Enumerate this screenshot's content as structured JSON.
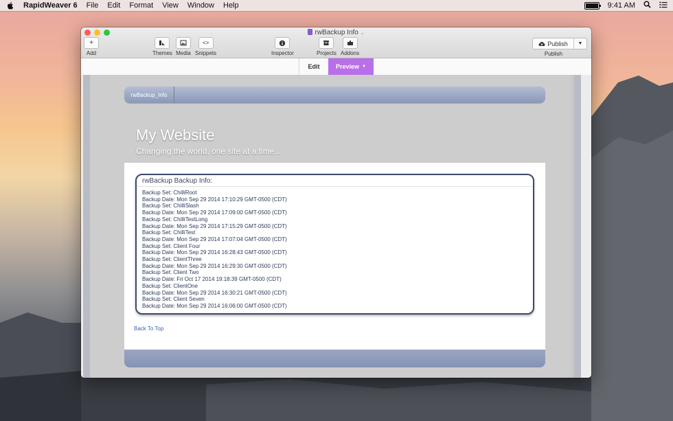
{
  "menubar": {
    "app_name": "RapidWeaver 6",
    "items": [
      "File",
      "Edit",
      "Format",
      "View",
      "Window",
      "Help"
    ],
    "clock": "9:41 AM"
  },
  "window": {
    "title": "rwBackup Info",
    "toolbar": {
      "add_label": "Add",
      "themes_label": "Themes",
      "media_label": "Media",
      "snippets_label": "Snippets",
      "inspector_label": "Inspector",
      "projects_label": "Projects",
      "addons_label": "Addons",
      "publish_button": "Publish",
      "publish_label": "Publish"
    },
    "modes": {
      "edit": "Edit",
      "preview": "Preview"
    }
  },
  "site": {
    "nav_item": "rwBackup_Info",
    "title": "My Website",
    "subtitle": "Changing the world, one site at a time...",
    "info_header": "rwBackup Backup Info:",
    "entries": [
      {
        "set": "Backup Set: ChilliRoot",
        "date": "Backup Date: Mon Sep 29 2014 17:10:29 GMT-0500 (CDT)"
      },
      {
        "set": "Backup Set: ChilliSlash",
        "date": "Backup Date: Mon Sep 29 2014 17:09:00 GMT-0500 (CDT)"
      },
      {
        "set": "Backup Set: ChilliTestLong",
        "date": "Backup Date: Mon Sep 29 2014 17:15:29 GMT-0500 (CDT)"
      },
      {
        "set": "Backup Set: ChilliTest",
        "date": "Backup Date: Mon Sep 29 2014 17:07:04 GMT-0500 (CDT)"
      },
      {
        "set": "Backup Set: Client Four",
        "date": "Backup Date: Mon Sep 29 2014 16:28:43 GMT-0500 (CDT)"
      },
      {
        "set": "Backup Set: ClientThree",
        "date": "Backup Date: Mon Sep 29 2014 16:29:30 GMT-0500 (CDT)"
      },
      {
        "set": "Backup Set: Client Two",
        "date": "Backup Date: Fri Oct 17 2014 19:18:39 GMT-0500 (CDT)"
      },
      {
        "set": "Backup Set: ClientOne",
        "date": "Backup Date: Mon Sep 29 2014 16:30:21 GMT-0500 (CDT)"
      },
      {
        "set": "Backup Set: Client Seven",
        "date": "Backup Date: Mon Sep 29 2014 16:06:00 GMT-0500 (CDT)"
      }
    ],
    "back_to_top": "Back To Top"
  },
  "colors": {
    "preview_accent": "#b86fe8",
    "nav_bar": "#8a98b8",
    "info_border": "#3c4a6a",
    "link": "#3a64a8"
  }
}
